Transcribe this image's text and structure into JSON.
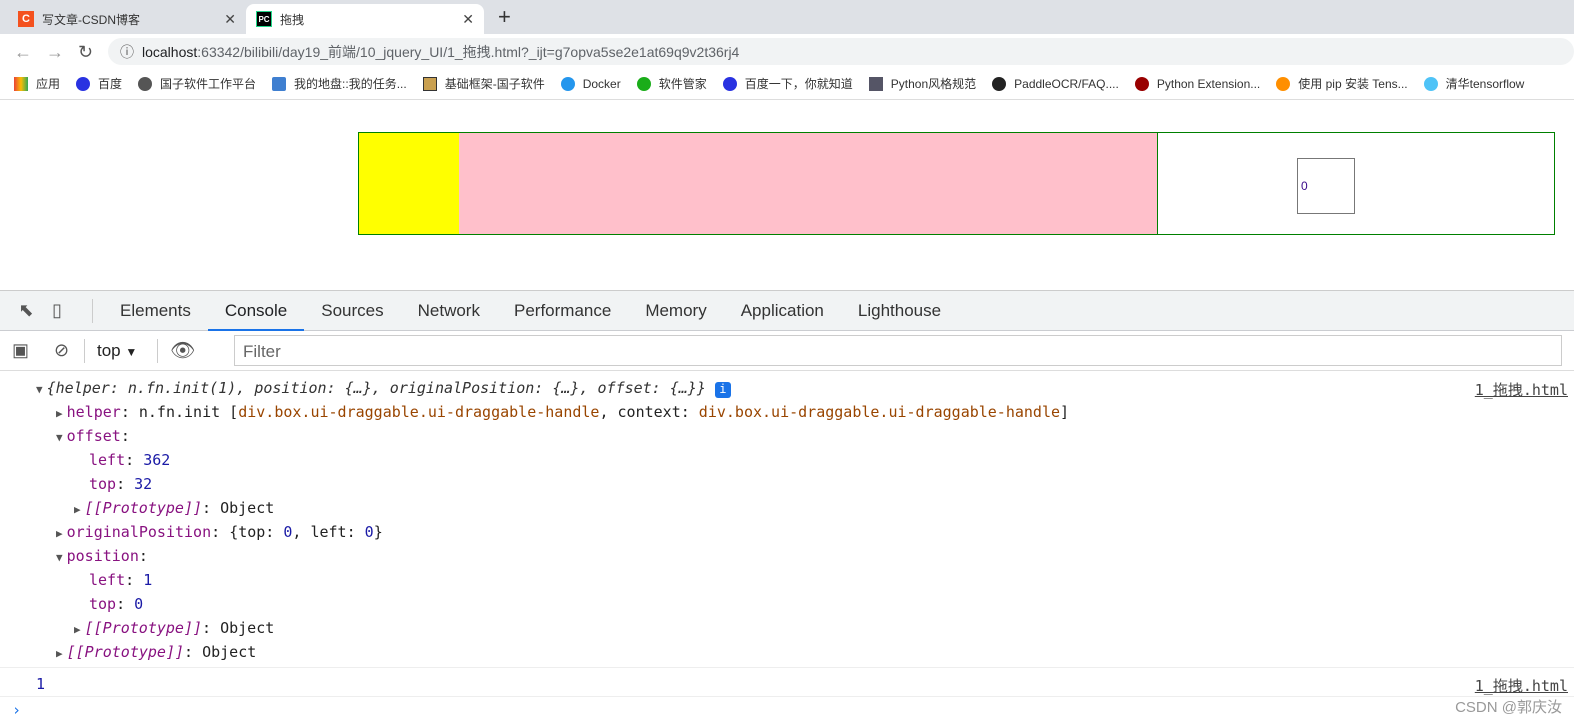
{
  "browser": {
    "tabs": [
      {
        "title": "写文章-CSDN博客",
        "icon": "csdn-icon",
        "active": false
      },
      {
        "title": "拖拽",
        "icon": "pycharm-icon",
        "active": true
      }
    ],
    "url_host": "localhost",
    "url_rest": ":63342/bilibili/day19_前端/10_jquery_UI/1_拖拽.html?_ijt=g7opva5se2e1at69q9v2t36rj4",
    "bookmarks": [
      "应用",
      "百度",
      "国子软件工作平台",
      "我的地盘::我的任务...",
      "基础框架-国子软件",
      "Docker",
      "软件管家",
      "百度一下，你就知道",
      "Python风格规范",
      "PaddleOCR/FAQ....",
      "Python Extension...",
      "使用 pip 安装 Tens...",
      "清华tensorflow"
    ]
  },
  "page": {
    "box_text": "0",
    "colors": {
      "yellow": "#ffff00",
      "pink": "#ffc0cb",
      "border": "#008000"
    }
  },
  "devtools": {
    "tabs": [
      "Elements",
      "Console",
      "Sources",
      "Network",
      "Performance",
      "Memory",
      "Application",
      "Lighthouse"
    ],
    "active_tab": "Console",
    "context": "top",
    "filter_placeholder": "Filter",
    "console": {
      "summary": "{helper: n.fn.init(1), position: {…}, originalPosition: {…}, offset: {…}}",
      "source": "1_拖拽.html",
      "helper_key": "helper",
      "helper_val": "n.fn.init [",
      "helper_sel": "div.box.ui-draggable.ui-draggable-handle",
      "helper_ctx": ", context: ",
      "helper_end": "]",
      "offset_key": "offset",
      "offset_left": "362",
      "offset_top": "32",
      "proto": "[[Prototype]]",
      "proto_val": "Object",
      "orig_key": "originalPosition",
      "orig_val_a": "{top: ",
      "orig_top": "0",
      "orig_val_b": ", left: ",
      "orig_left": "0",
      "orig_val_c": "}",
      "pos_key": "position",
      "pos_left": "1",
      "pos_top": "0",
      "log2": "1"
    },
    "watermark": "CSDN @郭庆汝"
  }
}
